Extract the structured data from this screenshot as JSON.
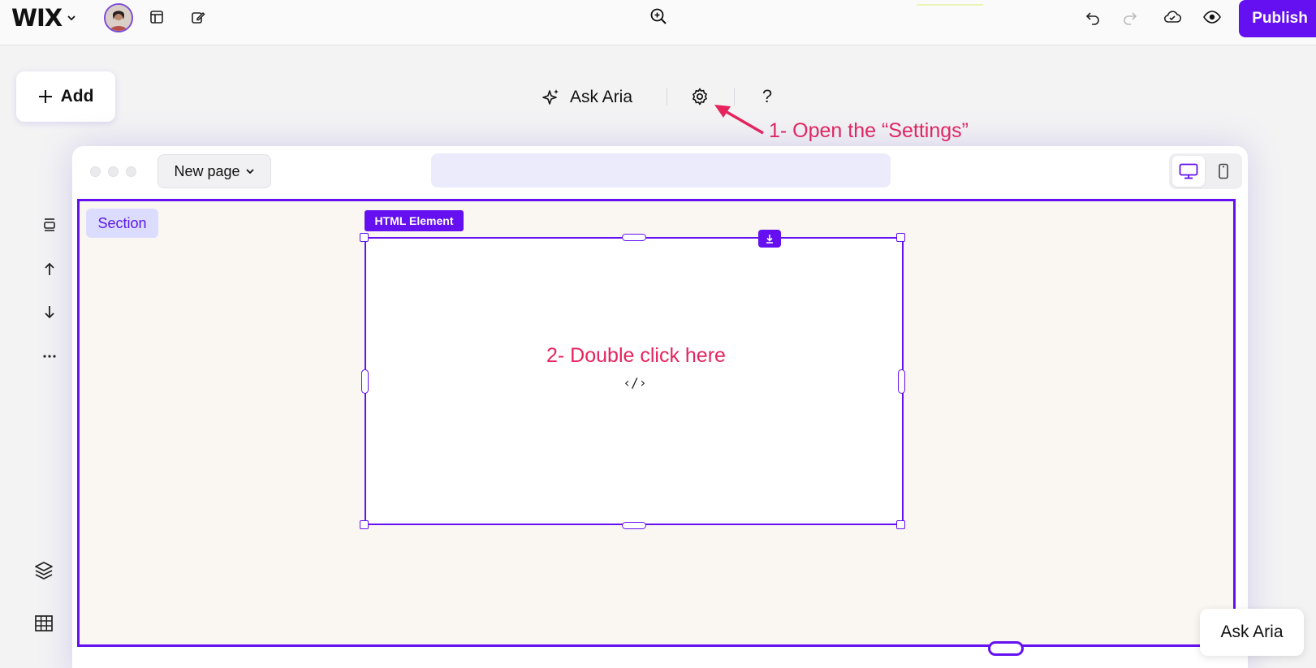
{
  "topbar": {
    "logo": "WIX",
    "publish_label": "Publish"
  },
  "add": {
    "label": "Add"
  },
  "floating_toolbar": {
    "ask_aria_label": "Ask Aria",
    "help_label": "?"
  },
  "annotations": {
    "settings_hint": "1- Open the “Settings”",
    "double_click_hint": "2- Double click here"
  },
  "browser": {
    "page_selector": "New page",
    "url_value": ""
  },
  "canvas": {
    "section_label": "Section",
    "element_label": "HTML Element",
    "code_glyph": "‹/›"
  },
  "bottom_aria": {
    "label": "Ask Aria"
  },
  "colors": {
    "accent": "#6410f0",
    "annotation": "#e5245e",
    "section_bg": "#faf6f2"
  }
}
